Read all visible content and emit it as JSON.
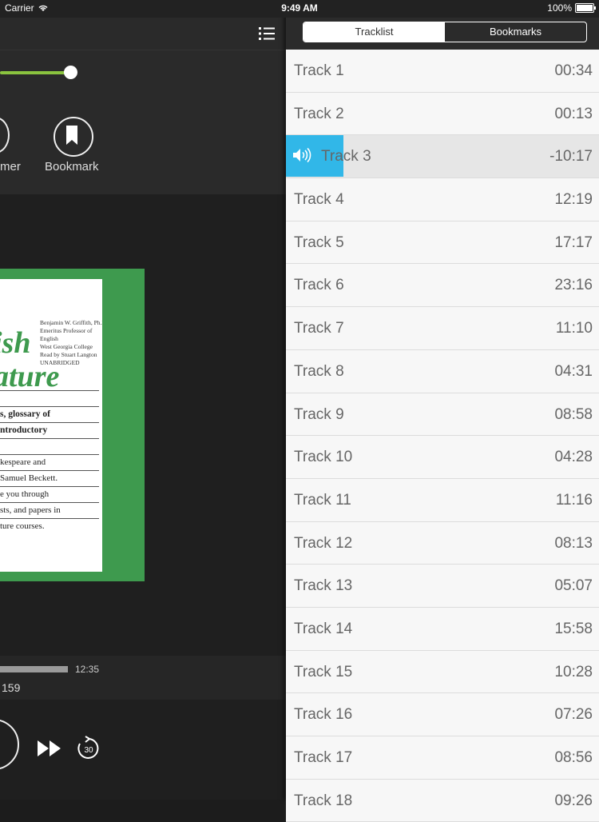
{
  "status": {
    "carrier": "Carrier",
    "time": "9:49 AM",
    "battery": "100%"
  },
  "player": {
    "actions": {
      "timer_label": "mer",
      "bookmark_label": "Bookmark"
    },
    "cover": {
      "title_lines": [
        "ish",
        "ature"
      ],
      "author_lines": [
        "Benjamin W. Griffith, Ph.D.",
        "Emeritus Professor of English",
        "West Georgia College",
        "Read by Stuart Langton",
        "UNABRIDGED"
      ],
      "bold_lines": [
        "s, glossary of",
        "ntroductory"
      ],
      "body_lines": [
        "kespeare and",
        "Samuel Beckett.",
        "e you through",
        "sts, and papers in",
        "ture courses."
      ]
    },
    "elapsed_time": "12:35",
    "page": "159",
    "skip_seconds": "30"
  },
  "tabs": {
    "tracklist": "Tracklist",
    "bookmarks": "Bookmarks"
  },
  "tracks": [
    {
      "name": "Track 1",
      "duration": "00:34"
    },
    {
      "name": "Track 2",
      "duration": "00:13"
    },
    {
      "name": "Track 3",
      "duration": "-10:17"
    },
    {
      "name": "Track 4",
      "duration": "12:19"
    },
    {
      "name": "Track 5",
      "duration": "17:17"
    },
    {
      "name": "Track 6",
      "duration": "23:16"
    },
    {
      "name": "Track 7",
      "duration": "11:10"
    },
    {
      "name": "Track 8",
      "duration": "04:31"
    },
    {
      "name": "Track 9",
      "duration": "08:58"
    },
    {
      "name": "Track 10",
      "duration": "04:28"
    },
    {
      "name": "Track 11",
      "duration": "11:16"
    },
    {
      "name": "Track 12",
      "duration": "08:13"
    },
    {
      "name": "Track 13",
      "duration": "05:07"
    },
    {
      "name": "Track 14",
      "duration": "15:58"
    },
    {
      "name": "Track 15",
      "duration": "10:28"
    },
    {
      "name": "Track 16",
      "duration": "07:26"
    },
    {
      "name": "Track 17",
      "duration": "08:56"
    },
    {
      "name": "Track 18",
      "duration": "09:26"
    }
  ],
  "colors": {
    "accent_green": "#8ac33f",
    "now_playing_blue": "#31b7e8",
    "cover_green": "#3e9a4e"
  }
}
